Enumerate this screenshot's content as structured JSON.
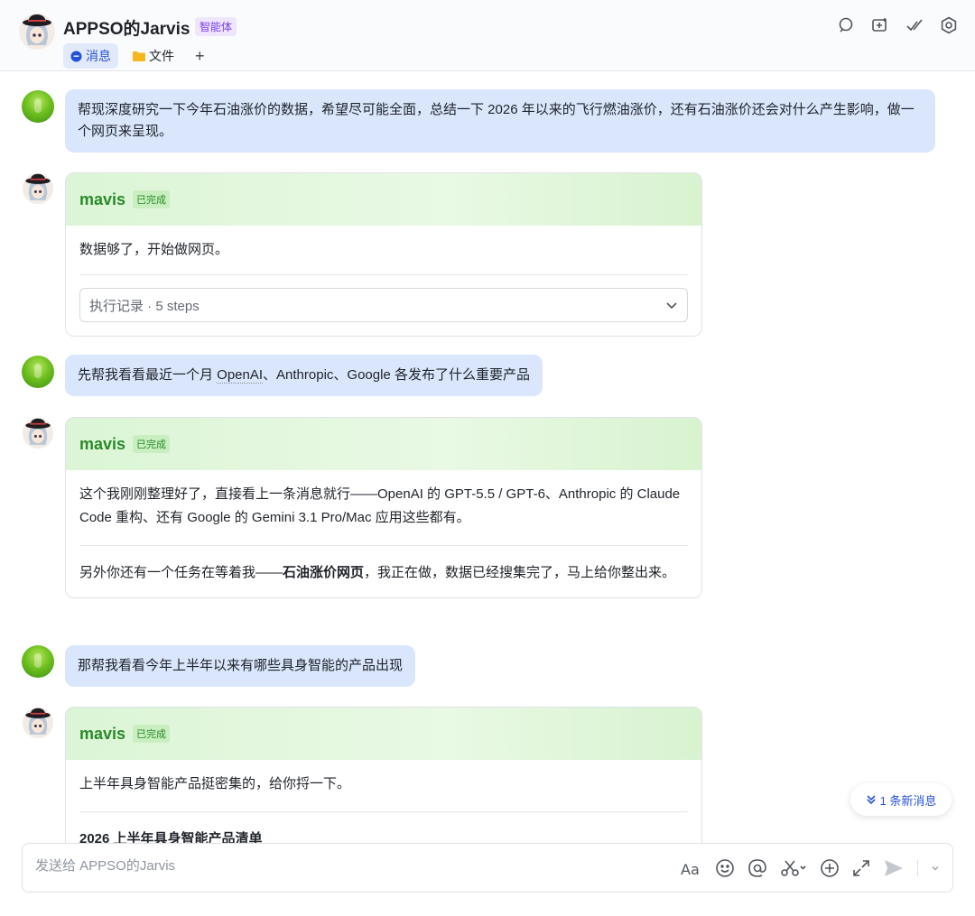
{
  "header": {
    "title": "APPSO的Jarvis",
    "badge": "智能体",
    "tabs": [
      {
        "label": "消息",
        "icon": "chat-bubble-icon"
      },
      {
        "label": "文件",
        "icon": "folder-icon"
      },
      {
        "label": "+",
        "icon": "plus-icon"
      }
    ],
    "icons": [
      "search-chat-icon",
      "new-window-icon",
      "checkmark-icon",
      "settings-gear-icon"
    ]
  },
  "messages": [
    {
      "user_text": "帮现深度研究一下今年石油涨价的数据，希望尽可能全面，总结一下 2026 年以来的飞行燃油涨价，还有石油涨价还会对什么产生影响，做一个网页来呈现。"
    },
    {
      "bot_name": "mavis",
      "status": "已完成",
      "text": "数据够了，开始做网页。",
      "steps": "执行记录 · 5 steps"
    },
    {
      "user_pre": "先帮我看看最近一个月 ",
      "user_link": "OpenAI",
      "user_post": "、Anthropic、Google 各发布了什么重要产品"
    },
    {
      "bot_name": "mavis",
      "status": "已完成",
      "para1": "这个我刚刚整理好了，直接看上一条消息就行——OpenAI 的 GPT-5.5 / GPT-6、Anthropic 的 Claude Code 重构、还有 Google 的 Gemini 3.1 Pro/Mac 应用这些都有。",
      "para2_pre": "另外你还有一个任务在等着我——",
      "para2_bold": "石油涨价网页",
      "para2_post": "，我正在做，数据已经搜集完了，马上给你整出来。"
    },
    {
      "user_text": "那帮我看看今年上半年以来有哪些具身智能的产品出现"
    },
    {
      "bot_name": "mavis",
      "status": "已完成",
      "text": "上半年具身智能产品挺密集的，给你捋一下。",
      "partial_heading": "2026 上半年具身智能产品清单"
    }
  ],
  "new_messages": "1 条新消息",
  "composer": {
    "placeholder": "发送给 APPSO的Jarvis",
    "tools": [
      "text-format-icon",
      "emoji-icon",
      "mention-icon",
      "screenshot-scissors-icon",
      "plus-circle-icon",
      "expand-icon",
      "send-icon",
      "dropdown-icon"
    ]
  },
  "colors": {
    "accent": "#2453d6",
    "bot_green": "#2a8a2a",
    "user_bubble": "#d9e6fc",
    "badge_purple": "#7a3ce6"
  }
}
